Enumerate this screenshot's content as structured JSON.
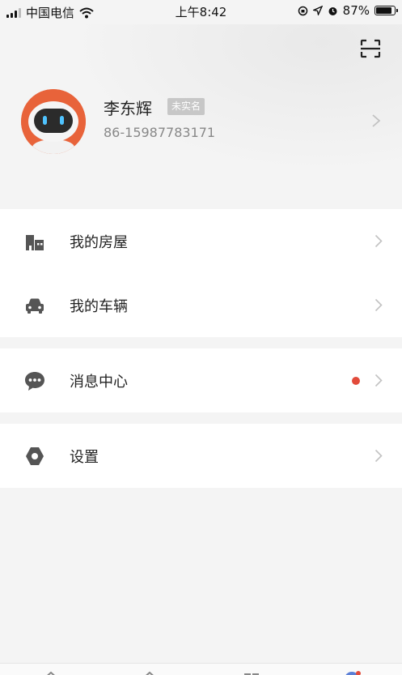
{
  "status_bar": {
    "carrier": "中国电信",
    "time": "上午8:42",
    "battery": "87%",
    "battery_level": 0.87
  },
  "header": {
    "scan_icon": "scan-icon"
  },
  "profile": {
    "name": "李东辉",
    "badge": "未实名",
    "phone": "86-15987783171",
    "avatar_icon": "robot-avatar"
  },
  "menu": {
    "house": {
      "label": "我的房屋",
      "icon": "building-icon"
    },
    "vehicle": {
      "label": "我的车辆",
      "icon": "car-icon"
    },
    "messages": {
      "label": "消息中心",
      "icon": "chat-bubble-icon",
      "unread": true
    },
    "settings": {
      "label": "设置",
      "icon": "hexagon-settings-icon"
    }
  },
  "colors": {
    "background": "#f4f4f4",
    "card": "#ffffff",
    "accent_orange": "#e8633a",
    "unread_dot": "#e24b3b",
    "icon_gray": "#555555"
  }
}
